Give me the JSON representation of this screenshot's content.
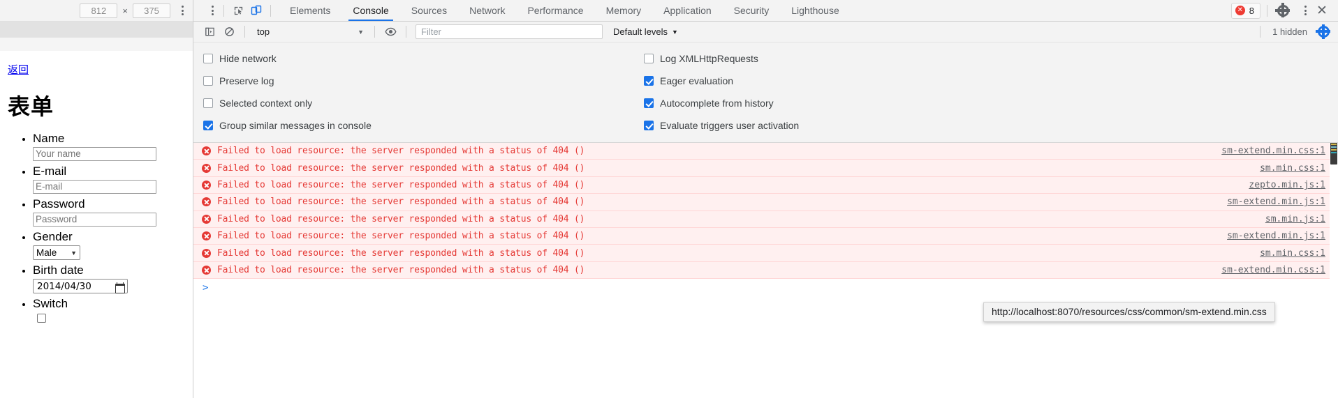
{
  "device_toolbar": {
    "width_value": "812",
    "height_value": "375",
    "separator": "×",
    "menu_icon": "kebab-menu-icon"
  },
  "page": {
    "back_link": "返回",
    "title": "表单",
    "fields": [
      {
        "label": "Name",
        "type": "text",
        "placeholder": "Your name",
        "value": ""
      },
      {
        "label": "E-mail",
        "type": "text",
        "placeholder": "E-mail",
        "value": ""
      },
      {
        "label": "Password",
        "type": "text",
        "placeholder": "Password",
        "value": ""
      },
      {
        "label": "Gender",
        "type": "select",
        "value": "Male"
      },
      {
        "label": "Birth date",
        "type": "date",
        "value": "2014/04/30"
      },
      {
        "label": "Switch",
        "type": "checkbox",
        "value": ""
      }
    ]
  },
  "devtools": {
    "inspect_icon": "inspect-element-icon",
    "device_icon": "toggle-device-toolbar-icon",
    "tabs": [
      {
        "label": "Elements",
        "active": false
      },
      {
        "label": "Console",
        "active": true
      },
      {
        "label": "Sources",
        "active": false
      },
      {
        "label": "Network",
        "active": false
      },
      {
        "label": "Performance",
        "active": false
      },
      {
        "label": "Memory",
        "active": false
      },
      {
        "label": "Application",
        "active": false
      },
      {
        "label": "Security",
        "active": false
      },
      {
        "label": "Lighthouse",
        "active": false
      }
    ],
    "error_count": "8",
    "settings_icon": "gear-icon",
    "more_icon": "kebab-menu-icon",
    "close_icon": "close-icon",
    "accent_color": "#1a73e8",
    "error_color": "#e53935"
  },
  "console_bar": {
    "sidebar_icon": "console-sidebar-icon",
    "clear_icon": "clear-console-icon",
    "context": "top",
    "eye_icon": "live-expression-icon",
    "filter_placeholder": "Filter",
    "filter_value": "",
    "levels": "Default levels",
    "hidden_label": "1 hidden",
    "settings_icon": "gear-icon"
  },
  "settings_panel": {
    "left_column": [
      {
        "label": "Hide network",
        "checked": false
      },
      {
        "label": "Preserve log",
        "checked": false
      },
      {
        "label": "Selected context only",
        "checked": false
      },
      {
        "label": "Group similar messages in console",
        "checked": true
      }
    ],
    "right_column": [
      {
        "label": "Log XMLHttpRequests",
        "checked": false
      },
      {
        "label": "Eager evaluation",
        "checked": true
      },
      {
        "label": "Autocomplete from history",
        "checked": true
      },
      {
        "label": "Evaluate triggers user activation",
        "checked": true
      }
    ]
  },
  "console_messages": [
    {
      "text": "Failed to load resource: the server responded with a status of 404 ()",
      "source": "sm-extend.min.css:1"
    },
    {
      "text": "Failed to load resource: the server responded with a status of 404 ()",
      "source": "sm.min.css:1"
    },
    {
      "text": "Failed to load resource: the server responded with a status of 404 ()",
      "source": "zepto.min.js:1"
    },
    {
      "text": "Failed to load resource: the server responded with a status of 404 ()",
      "source": "sm-extend.min.js:1"
    },
    {
      "text": "Failed to load resource: the server responded with a status of 404 ()",
      "source": "sm.min.js:1"
    },
    {
      "text": "Failed to load resource: the server responded with a status of 404 ()",
      "source": "sm-extend.min.js:1"
    },
    {
      "text": "Failed to load resource: the server responded with a status of 404 ()",
      "source": "sm.min.css:1"
    },
    {
      "text": "Failed to load resource: the server responded with a status of 404 ()",
      "source": "sm-extend.min.css:1"
    }
  ],
  "tooltip": {
    "text": "http://localhost:8070/resources/css/common/sm-extend.min.css"
  },
  "prompt": {
    "chevron": ">"
  }
}
